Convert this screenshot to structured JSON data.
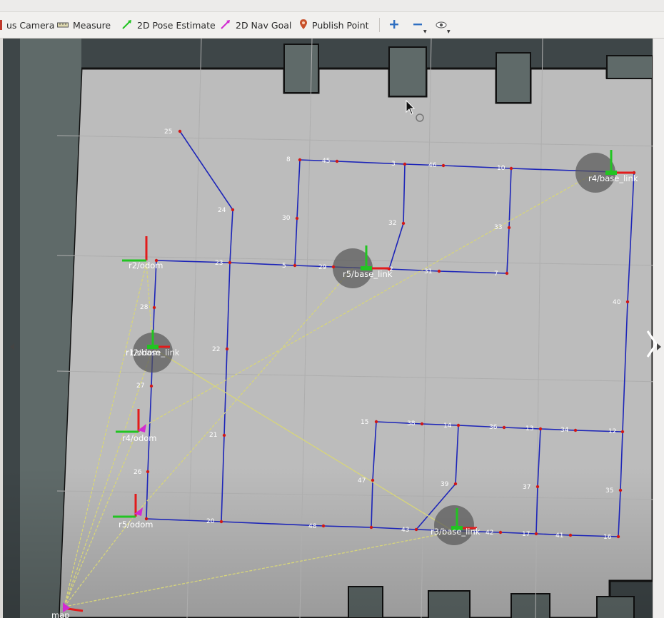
{
  "toolbar": {
    "tools": [
      {
        "label": "us Camera",
        "icon": "camera-icon"
      },
      {
        "label": "Measure",
        "icon": "ruler-icon"
      },
      {
        "label": "2D Pose Estimate",
        "icon": "green-arrow-icon"
      },
      {
        "label": "2D Nav Goal",
        "icon": "magenta-arrow-icon"
      },
      {
        "label": "Publish Point",
        "icon": "map-pin-icon"
      }
    ],
    "extra_icons": [
      "plus-icon",
      "minus-icon",
      "eye-icon"
    ]
  },
  "viewport": {
    "waypoints": [
      "25",
      "8",
      "45",
      "3",
      "46",
      "10",
      "24",
      "30",
      "32",
      "33",
      "23",
      "5",
      "29",
      "2",
      "31",
      "7",
      "28",
      "22",
      "40",
      "27",
      "21",
      "15",
      "38",
      "14",
      "36",
      "13",
      "34",
      "12",
      "26",
      "47",
      "39",
      "37",
      "35",
      "20",
      "48",
      "43",
      "42",
      "17",
      "41",
      "16"
    ],
    "frames": [
      "r2/odom",
      "r4/odom",
      "r5/odom",
      "r4/base_link",
      "r5/base_link",
      "r3/base_link",
      "map"
    ],
    "overlap_labels": [
      "r1/odom",
      "r2/base_link"
    ]
  }
}
